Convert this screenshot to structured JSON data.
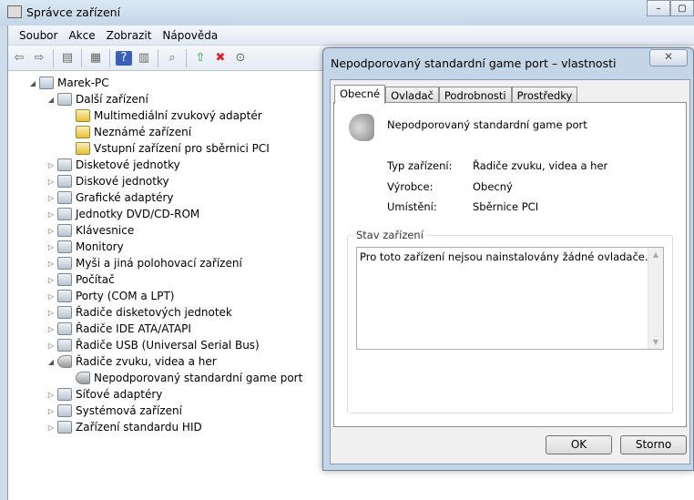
{
  "window": {
    "title": "Správce zařízení",
    "min": "–",
    "max": "▢"
  },
  "menu": [
    "Soubor",
    "Akce",
    "Zobrazit",
    "Nápověda"
  ],
  "tree": [
    {
      "label": "Marek-PC",
      "level": 0,
      "arrow": "◢",
      "icon": "computer"
    },
    {
      "label": "Další zařízení",
      "level": 1,
      "arrow": "◢",
      "icon": "unknown"
    },
    {
      "label": "Multimediální zvukový adaptér",
      "level": 2,
      "arrow": "",
      "icon": "warning"
    },
    {
      "label": "Neznámé zařízení",
      "level": 2,
      "arrow": "",
      "icon": "warning"
    },
    {
      "label": "Vstupní zařízení pro sběrnici PCI",
      "level": 2,
      "arrow": "",
      "icon": "warning"
    },
    {
      "label": "Disketové jednotky",
      "level": 1,
      "arrow": "▷",
      "icon": "device"
    },
    {
      "label": "Diskové jednotky",
      "level": 1,
      "arrow": "▷",
      "icon": "device"
    },
    {
      "label": "Grafické adaptéry",
      "level": 1,
      "arrow": "▷",
      "icon": "device"
    },
    {
      "label": "Jednotky DVD/CD-ROM",
      "level": 1,
      "arrow": "▷",
      "icon": "device"
    },
    {
      "label": "Klávesnice",
      "level": 1,
      "arrow": "▷",
      "icon": "device"
    },
    {
      "label": "Monitory",
      "level": 1,
      "arrow": "▷",
      "icon": "device"
    },
    {
      "label": "Myši a jiná polohovací zařízení",
      "level": 1,
      "arrow": "▷",
      "icon": "device"
    },
    {
      "label": "Počítač",
      "level": 1,
      "arrow": "▷",
      "icon": "device"
    },
    {
      "label": "Porty (COM a LPT)",
      "level": 1,
      "arrow": "▷",
      "icon": "device"
    },
    {
      "label": "Řadiče disketových jednotek",
      "level": 1,
      "arrow": "▷",
      "icon": "device"
    },
    {
      "label": "Řadiče IDE ATA/ATAPI",
      "level": 1,
      "arrow": "▷",
      "icon": "device"
    },
    {
      "label": "Řadiče USB (Universal Serial Bus)",
      "level": 1,
      "arrow": "▷",
      "icon": "device"
    },
    {
      "label": "Řadiče zvuku, videa a her",
      "level": 1,
      "arrow": "◢",
      "icon": "speaker"
    },
    {
      "label": "Nepodporovaný standardní game port",
      "level": 2,
      "arrow": "",
      "icon": "speaker"
    },
    {
      "label": "Síťové adaptéry",
      "level": 1,
      "arrow": "▷",
      "icon": "device"
    },
    {
      "label": "Systémová zařízení",
      "level": 1,
      "arrow": "▷",
      "icon": "device"
    },
    {
      "label": "Zařízení standardu HID",
      "level": 1,
      "arrow": "▷",
      "icon": "device"
    }
  ],
  "dialog": {
    "title": "Nepodporovaný standardní game port – vlastnosti",
    "close": "✕",
    "tabs": [
      "Obecné",
      "Ovladač",
      "Podrobnosti",
      "Prostředky"
    ],
    "device_name": "Nepodporovaný standardní game port",
    "props": [
      {
        "label": "Typ zařízení:",
        "value": "Řadiče zvuku, videa a her"
      },
      {
        "label": "Výrobce:",
        "value": "Obecný"
      },
      {
        "label": "Umístění:",
        "value": "Sběrnice PCI"
      }
    ],
    "status_label": "Stav zařízení",
    "status_text": "Pro toto zařízení nejsou nainstalovány žádné ovladače.",
    "ok": "OK",
    "cancel": "Storno"
  }
}
